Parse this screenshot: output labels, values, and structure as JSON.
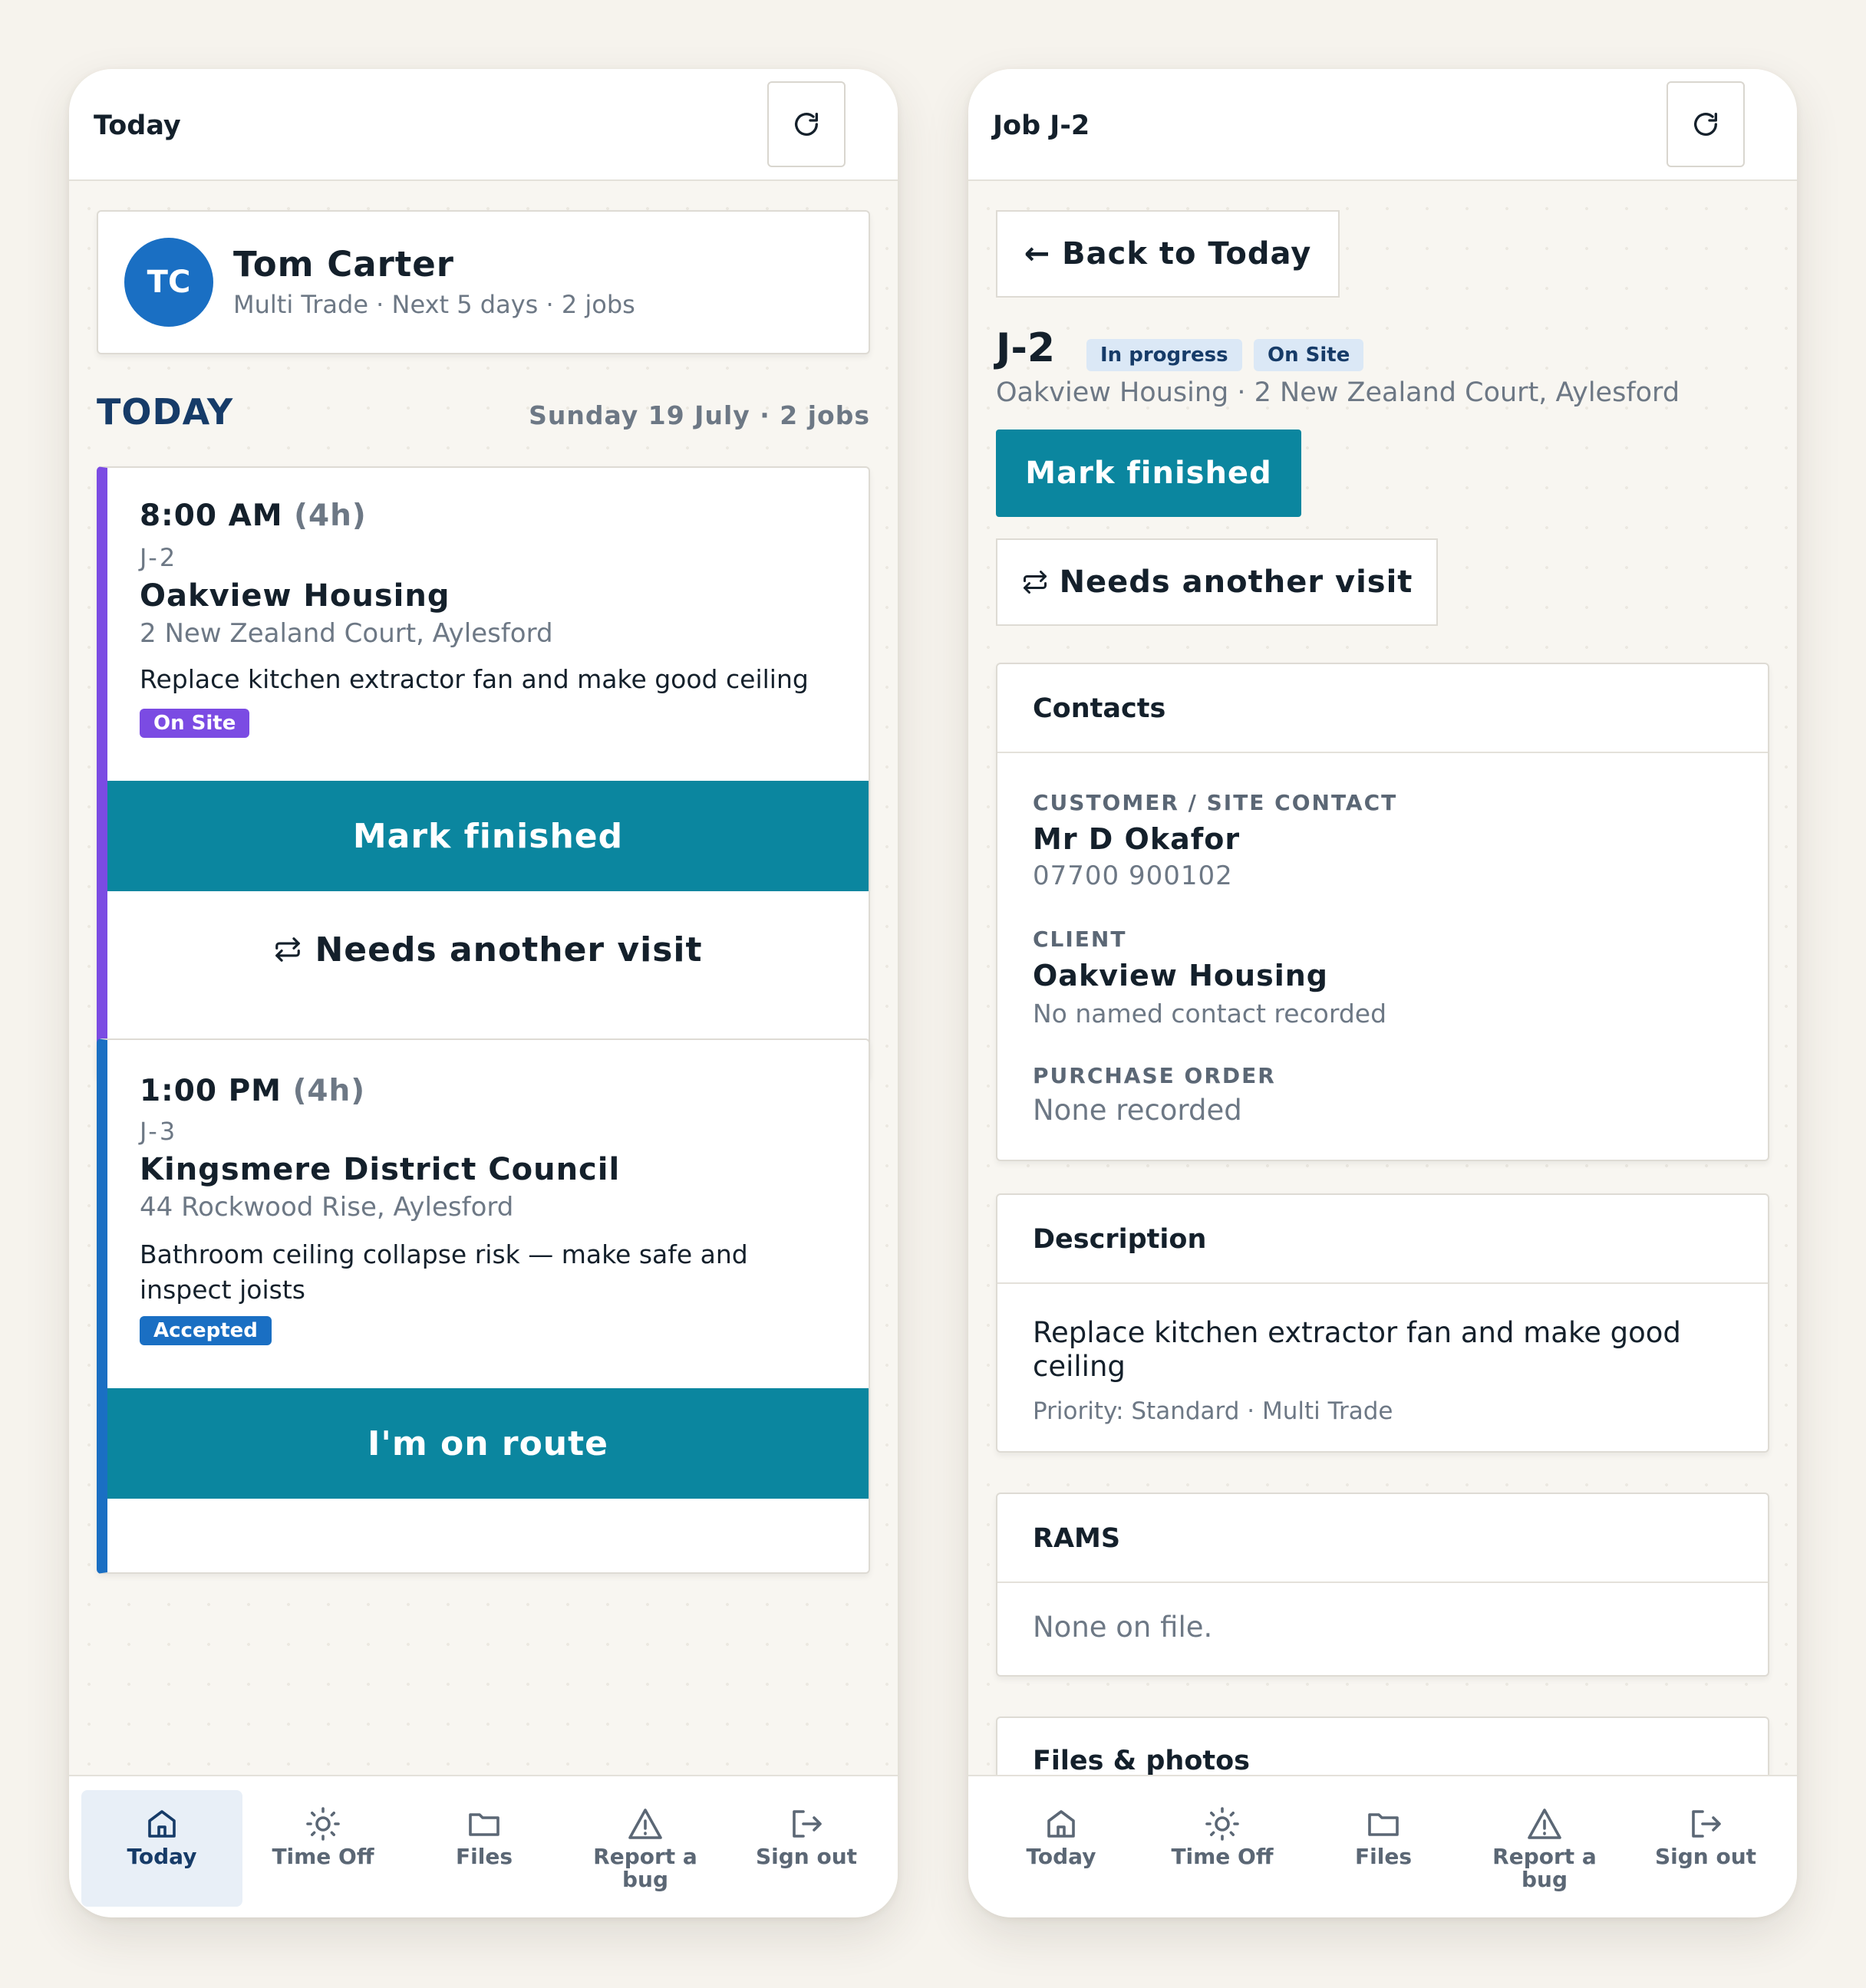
{
  "left": {
    "title": "Today",
    "profile": {
      "initials": "TC",
      "name": "Tom Carter",
      "subtitle": "Multi Trade · Next 5 days · 2 jobs"
    },
    "section_heading": "TODAY",
    "section_date": "Sunday 19 July · 2 jobs",
    "jobs": [
      {
        "time": "8:00 AM",
        "duration": "(4h)",
        "ref": "J-2",
        "client": "Oakview Housing",
        "address": "2 New Zealand Court, Aylesford",
        "description": "Replace kitchen extractor fan and make good ceiling",
        "status": "On Site",
        "primary_action": "Mark finished",
        "secondary_action": "Needs another visit",
        "accent": "#7b4be3"
      },
      {
        "time": "1:00 PM",
        "duration": "(4h)",
        "ref": "J-3",
        "client": "Kingsmere District Council",
        "address": "44 Rockwood Rise, Aylesford",
        "description_line1": "Bathroom ceiling collapse risk — make safe and",
        "description_line2": "inspect joists",
        "status": "Accepted",
        "primary_action": "I'm on route",
        "accent": "#1a6fc3"
      }
    ]
  },
  "right": {
    "title": "Job J-2",
    "back_label": "← Back to Today",
    "job_ref": "J-2",
    "badge_status": "In progress",
    "badge_stage": "On Site",
    "job_subtitle": "Oakview Housing · 2 New Zealand Court, Aylesford",
    "primary_action": "Mark finished",
    "secondary_action": "Needs another visit",
    "contacts": {
      "heading": "Contacts",
      "customer_label": "CUSTOMER / SITE CONTACT",
      "customer_name": "Mr D Okafor",
      "customer_phone": "07700 900102",
      "client_label": "CLIENT",
      "client_name": "Oakview Housing",
      "client_note": "No named contact recorded",
      "po_label": "PURCHASE ORDER",
      "po_value": "None recorded"
    },
    "description": {
      "heading": "Description",
      "line1": "Replace kitchen extractor fan and make good",
      "line2": "ceiling",
      "meta": "Priority: Standard · Multi Trade"
    },
    "rams": {
      "heading": "RAMS",
      "value": "None on file."
    },
    "files": {
      "heading": "Files & photos"
    }
  },
  "nav": {
    "today": "Today",
    "time_off": "Time Off",
    "files": "Files",
    "report_line1": "Report a",
    "report_line2": "bug",
    "sign_out": "Sign out"
  },
  "colors": {
    "teal": "#0b869f",
    "purple": "#7b4be3",
    "blue": "#1a6fc3",
    "navy": "#163b68"
  }
}
